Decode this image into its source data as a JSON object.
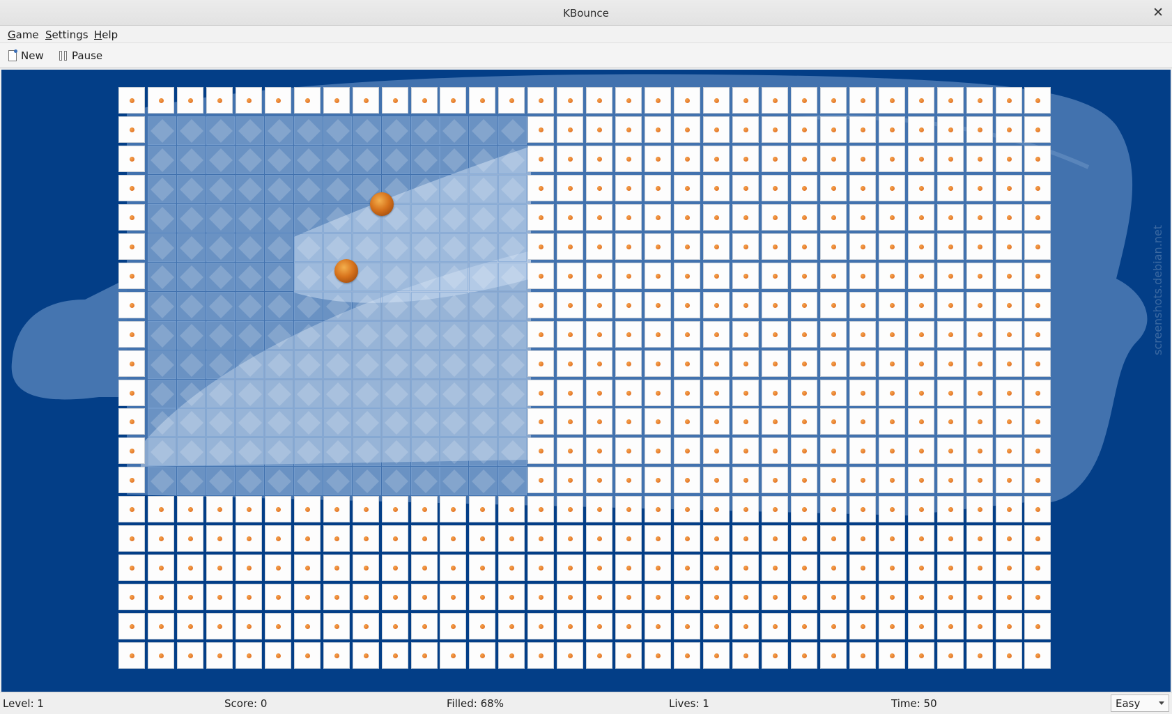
{
  "window": {
    "title": "KBounce",
    "close_icon": "close-icon"
  },
  "menu": {
    "items": [
      {
        "underline": "G",
        "rest": "ame"
      },
      {
        "underline": "S",
        "rest": "ettings"
      },
      {
        "underline": "H",
        "rest": "elp"
      }
    ]
  },
  "toolbar": {
    "new_label": "New",
    "new_icon": "new-document-icon",
    "pause_label": "Pause",
    "pause_icon": "pause-icon"
  },
  "game": {
    "columns": 32,
    "rows": 20,
    "filled_region": {
      "col_from": 1,
      "col_to": 13,
      "row_from": 1,
      "row_to": 13,
      "state": "open"
    },
    "balls": [
      {
        "col": 9,
        "row": 4,
        "color": "#d7731c"
      },
      {
        "col": 7.8,
        "row": 6.3,
        "color": "#d7731c"
      }
    ],
    "colors": {
      "background": "#033e87",
      "tile": "#fdfdfd",
      "tile_dot": "#e37620",
      "open_area": "#b4cdeb"
    }
  },
  "watermark": "screenshots.debian.net",
  "status": {
    "level": "Level: 1",
    "score": "Score: 0",
    "filled": "Filled: 68%",
    "lives": "Lives: 1",
    "time": "Time: 50",
    "difficulty": "Easy"
  }
}
